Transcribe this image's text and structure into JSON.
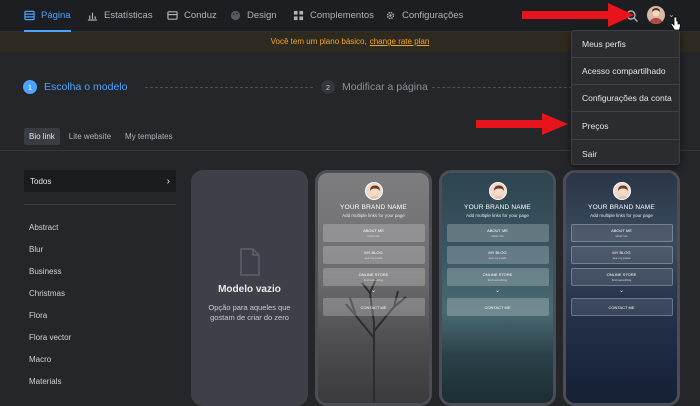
{
  "nav": {
    "items": [
      {
        "label": "Página",
        "icon": "layout-icon",
        "active": true
      },
      {
        "label": "Estatísticas",
        "icon": "bar-chart-icon",
        "active": false
      },
      {
        "label": "Conduz",
        "icon": "inbox-icon",
        "active": false
      },
      {
        "label": "Design",
        "icon": "palette-icon",
        "active": false
      },
      {
        "label": "Complementos",
        "icon": "grid-icon",
        "active": false
      },
      {
        "label": "Configurações",
        "icon": "gear-icon",
        "active": false
      }
    ],
    "accent_color": "#4ba3ff"
  },
  "banner": {
    "text": "Você tem um plano básico,",
    "link": "change rate plan",
    "color": "#f0a62a"
  },
  "steps": [
    {
      "number": "1",
      "label": "Escolha o modelo",
      "active": true
    },
    {
      "number": "2",
      "label": "Modificar a página",
      "active": false
    }
  ],
  "tabs": [
    "Bio link",
    "Lite website",
    "My templates"
  ],
  "categories": {
    "selected": "Todos",
    "items": [
      "Abstract",
      "Blur",
      "Business",
      "Christmas",
      "Flora",
      "Flora vector",
      "Macro",
      "Materials"
    ]
  },
  "blank_template": {
    "title": "Modelo vazio",
    "description_line1": "Opção para aqueles que",
    "description_line2": "gostam de criar do zero"
  },
  "template": {
    "brand": "YOUR BRAND NAME",
    "subtitle": "Add multiple links for your page",
    "buttons": [
      {
        "title": "ABOUT ME",
        "sub": "what I do"
      },
      {
        "title": "MY BLOG",
        "sub": "see my posts"
      },
      {
        "title": "ONLINE STORE",
        "sub": "find something"
      }
    ],
    "contact": "CONTACT ME"
  },
  "user_menu": {
    "items": [
      "Meus perfis",
      "Acesso compartilhado",
      "Configurações da conta",
      "Preços",
      "Sair"
    ]
  },
  "annotation_color": "#e8141b"
}
